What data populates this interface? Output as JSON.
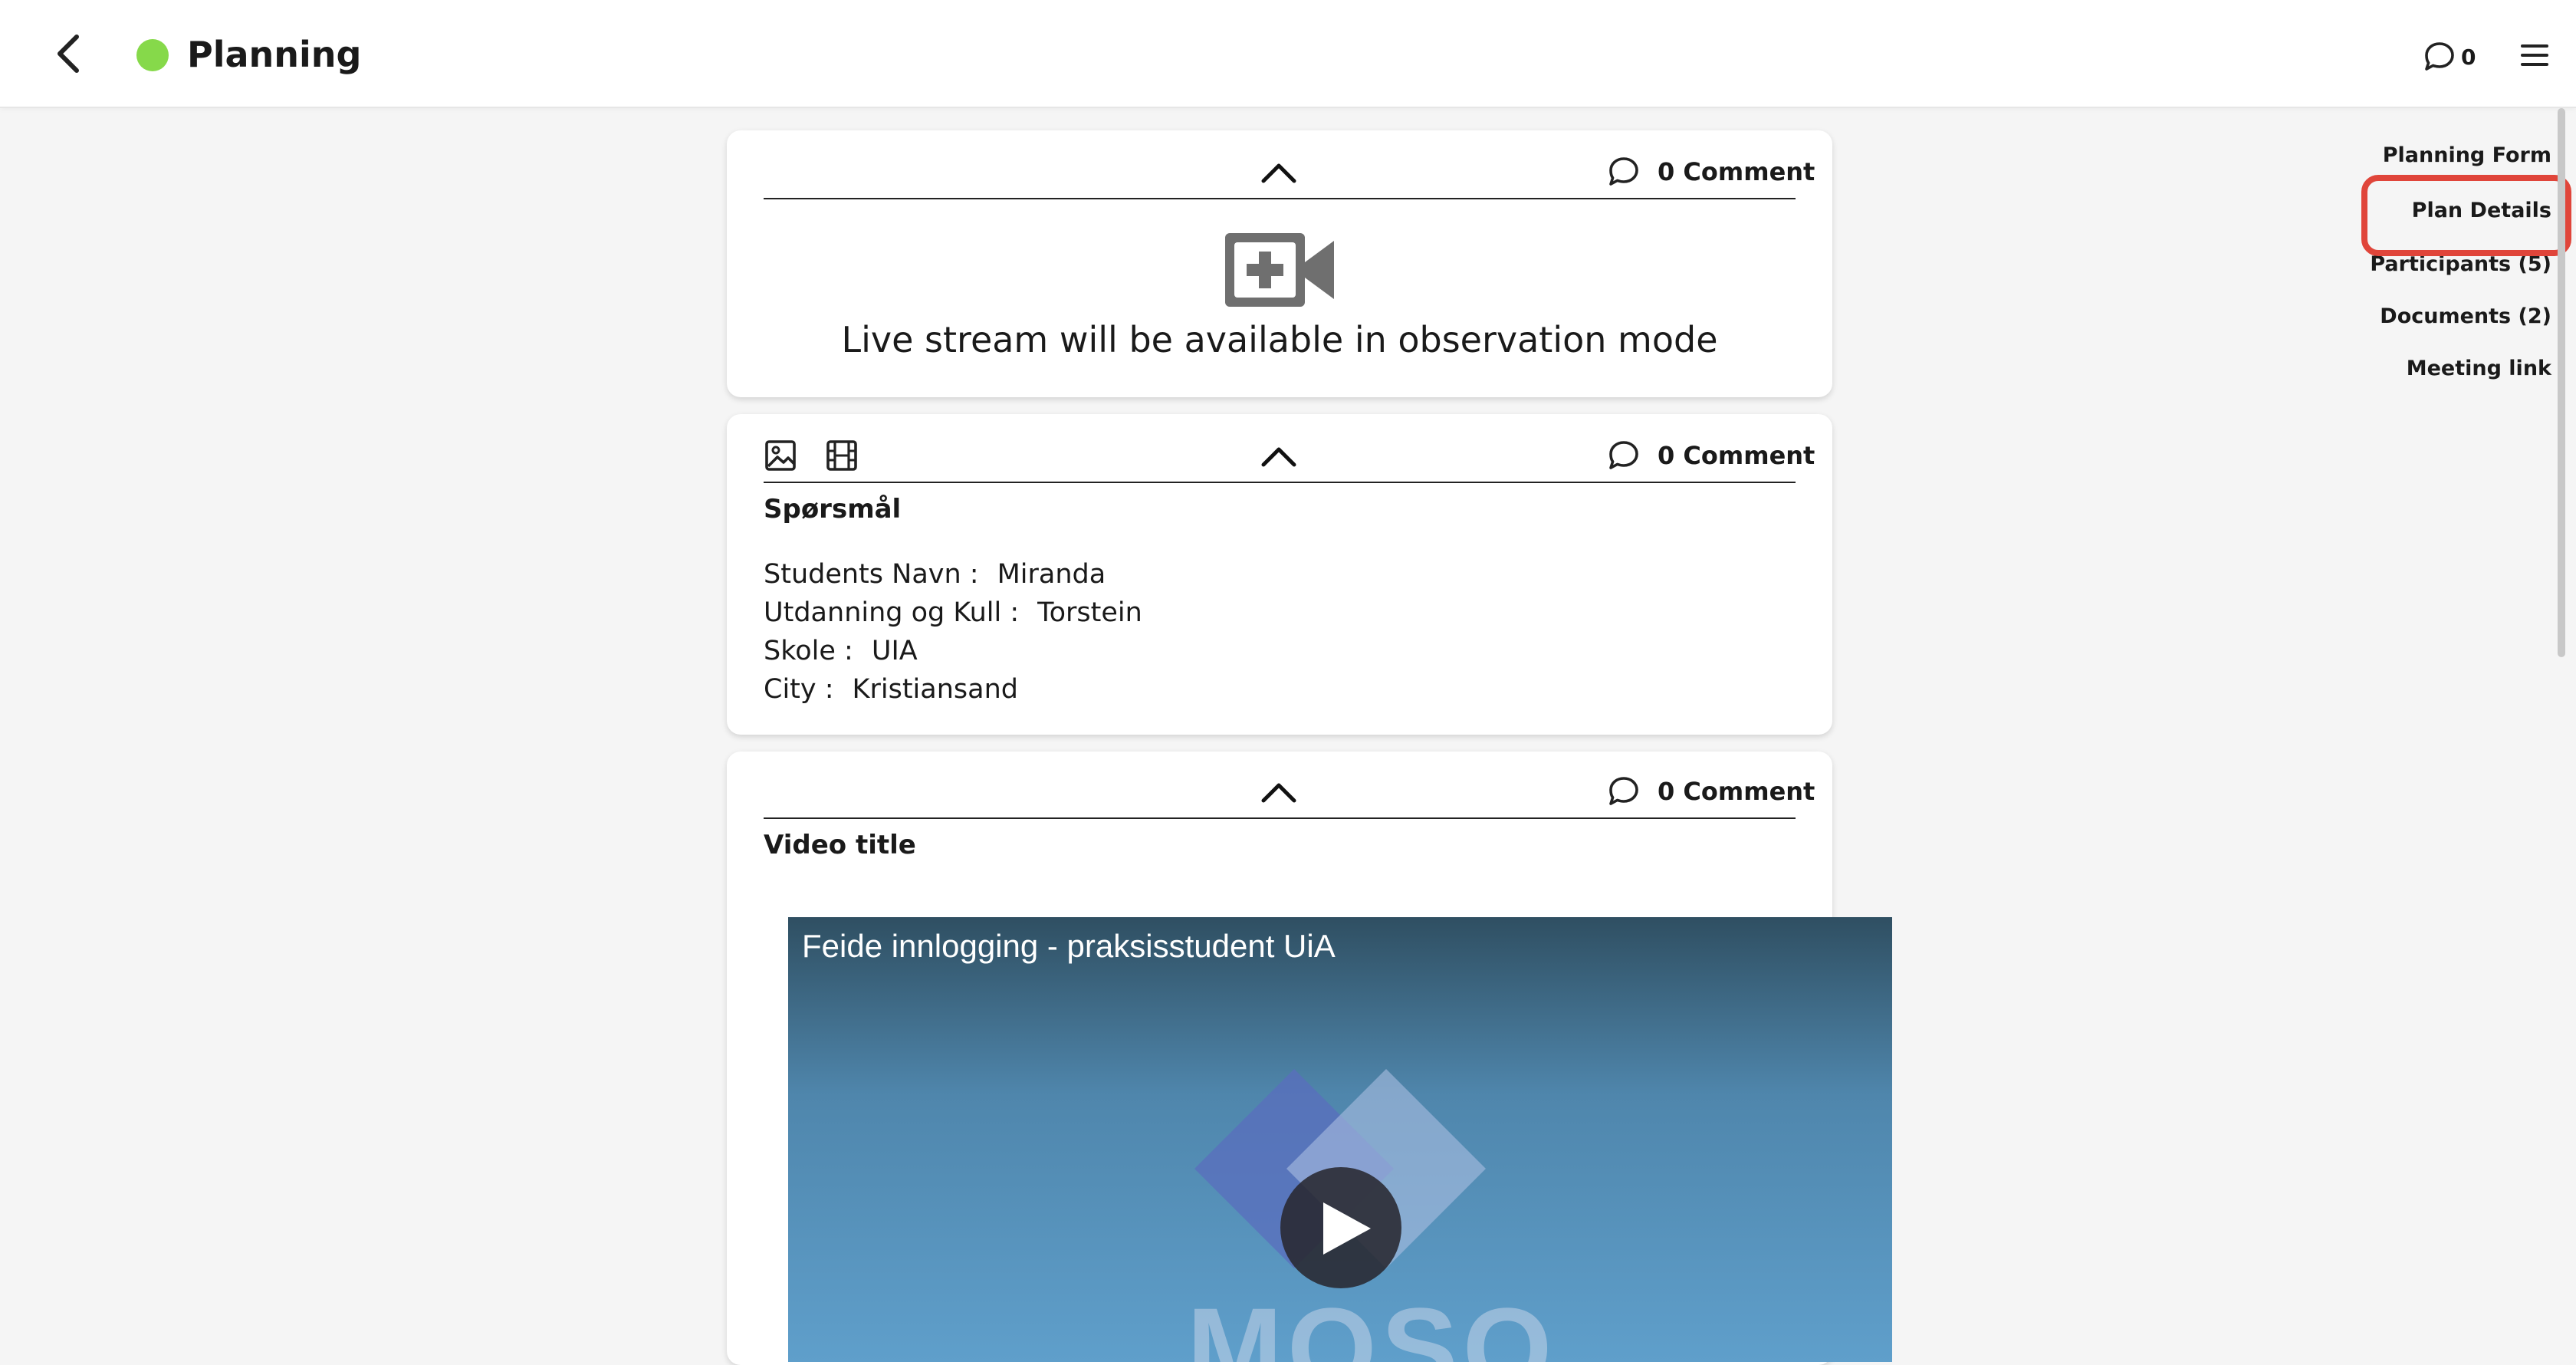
{
  "header": {
    "title": "Planning",
    "status_color": "#86d94a",
    "comment_count": "0"
  },
  "right_nav": {
    "items": [
      {
        "label": "Planning Form"
      },
      {
        "label": "Plan Details",
        "highlighted": true
      },
      {
        "label": "Participants (5)"
      },
      {
        "label": "Documents (2)"
      },
      {
        "label": "Meeting link"
      }
    ]
  },
  "cards": {
    "live": {
      "comment_label": "0 Comment",
      "message": "Live stream will be available in observation mode"
    },
    "questions": {
      "comment_label": "0 Comment",
      "title": "Spørsmål",
      "fields": [
        {
          "key": "Students Navn :",
          "value": "Miranda"
        },
        {
          "key": "Utdanning og Kull :",
          "value": "Torstein"
        },
        {
          "key": "Skole :",
          "value": "UIA"
        },
        {
          "key": "City :",
          "value": "Kristiansand"
        }
      ]
    },
    "video": {
      "comment_label": "0 Comment",
      "title": "Video title",
      "player_title": "Feide innlogging - praksisstudent UiA",
      "logo_text": "MOSO"
    }
  },
  "colors": {
    "accent_highlight": "#e0453a",
    "status": "#86d94a"
  },
  "icons": [
    "back-arrow-icon",
    "chat-bubble-icon",
    "hamburger-menu-icon",
    "chevron-up-icon",
    "video-add-icon",
    "image-icon",
    "film-icon",
    "play-icon"
  ]
}
